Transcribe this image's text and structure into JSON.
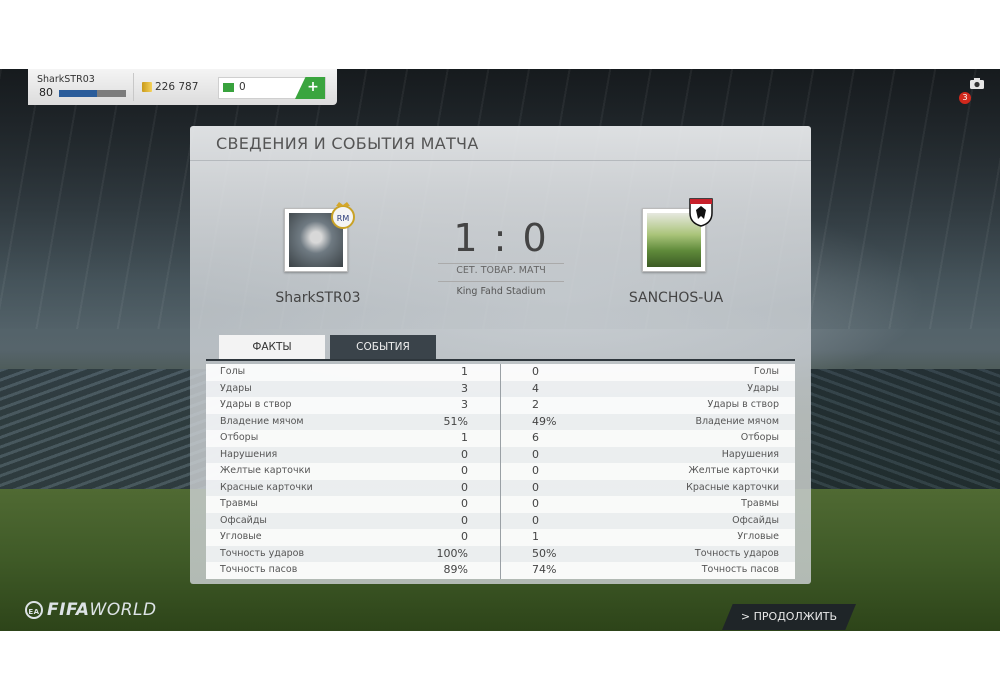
{
  "hud": {
    "username": "SharkSTR03",
    "level": "80",
    "xp_fraction": 0.57,
    "coins": "226 787",
    "cash": "0",
    "add_label": "+"
  },
  "notifications": {
    "count": "3"
  },
  "panel": {
    "title": "СВЕДЕНИЯ И СОБЫТИЯ МАТЧА",
    "home_name": "SharkSTR03",
    "away_name": "SANCHOS-UA",
    "score": "1 : 0",
    "match_type": "СЕТ. ТОВАР. МАТЧ",
    "stadium": "King Fahd Stadium"
  },
  "tabs": {
    "facts": "ФАКТЫ",
    "events": "СОБЫТИЯ"
  },
  "stats": [
    {
      "label": "Голы",
      "home": "1",
      "away": "0"
    },
    {
      "label": "Удары",
      "home": "3",
      "away": "4"
    },
    {
      "label": "Удары в створ",
      "home": "3",
      "away": "2"
    },
    {
      "label": "Владение мячом",
      "home": "51%",
      "away": "49%"
    },
    {
      "label": "Отборы",
      "home": "1",
      "away": "6"
    },
    {
      "label": "Нарушения",
      "home": "0",
      "away": "0"
    },
    {
      "label": "Желтые карточки",
      "home": "0",
      "away": "0"
    },
    {
      "label": "Красные карточки",
      "home": "0",
      "away": "0"
    },
    {
      "label": "Травмы",
      "home": "0",
      "away": "0"
    },
    {
      "label": "Офсайды",
      "home": "0",
      "away": "0"
    },
    {
      "label": "Угловые",
      "home": "0",
      "away": "1"
    },
    {
      "label": "Точность ударов",
      "home": "100%",
      "away": "50%"
    },
    {
      "label": "Точность пасов",
      "home": "89%",
      "away": "74%"
    }
  ],
  "footer": {
    "logo_ea": "EA",
    "logo_bold": "FIFA",
    "logo_light": "WORLD",
    "continue_label": "> ПРОДОЛЖИТЬ"
  },
  "colors": {
    "cash_green": "#3aa53e",
    "xp_blue": "#2a5c9a",
    "notif_red": "#d0281c",
    "tab_dark": "#3a434a"
  },
  "icons": {
    "coins": "coin-stack-icon",
    "cash": "cash-icon",
    "camera": "camera-icon"
  }
}
